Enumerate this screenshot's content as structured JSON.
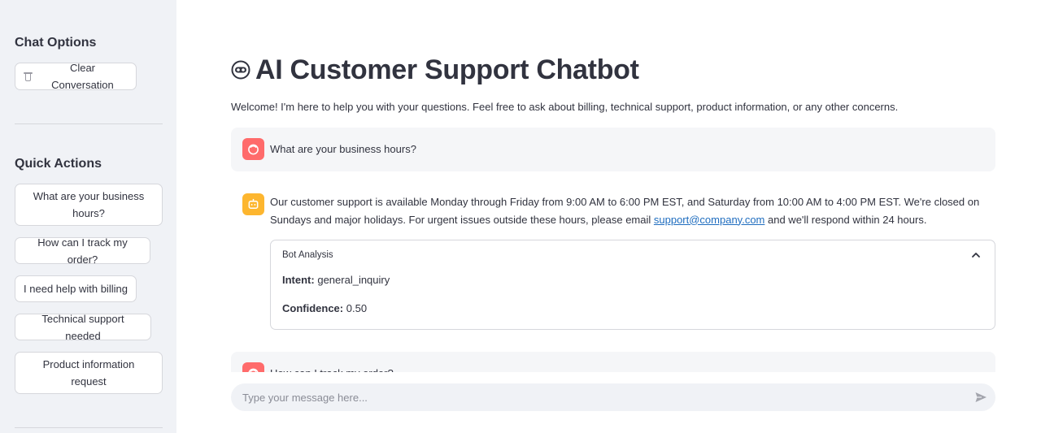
{
  "sidebar": {
    "chat_options_heading": "Chat Options",
    "clear_label": "Clear Conversation",
    "quick_actions_heading": "Quick Actions",
    "quick_actions": [
      "What are your business hours?",
      "How can I track my order?",
      "I need help with billing",
      "Technical support needed",
      "Product information request"
    ]
  },
  "main": {
    "title": "AI Customer Support Chatbot",
    "title_icon": "robot-face-icon",
    "welcome": "Welcome! I'm here to help you with your questions. Feel free to ask about billing, technical support, product information, or any other concerns.",
    "messages": [
      {
        "role": "user",
        "text": "What are your business hours?"
      },
      {
        "role": "assistant",
        "text_before": "Our customer support is available Monday through Friday from 9:00 AM to 6:00 PM EST, and Saturday from 10:00 AM to 4:00 PM EST. We're closed on Sundays and major holidays. For urgent issues outside these hours, please email ",
        "link": "support@company.com",
        "text_after": " and we'll respond within 24 hours.",
        "analysis": {
          "title": "Bot Analysis",
          "intent_label": "Intent:",
          "intent_value": "general_inquiry",
          "confidence_label": "Confidence:",
          "confidence_value": "0.50"
        }
      },
      {
        "role": "user",
        "text": "How can I track my order?"
      }
    ]
  },
  "input": {
    "placeholder": "Type your message here..."
  },
  "colors": {
    "sidebar_bg": "#f0f2f6",
    "user_avatar": "#ff6b6b",
    "bot_avatar": "#fdb62f",
    "link": "#1f6dbf"
  }
}
